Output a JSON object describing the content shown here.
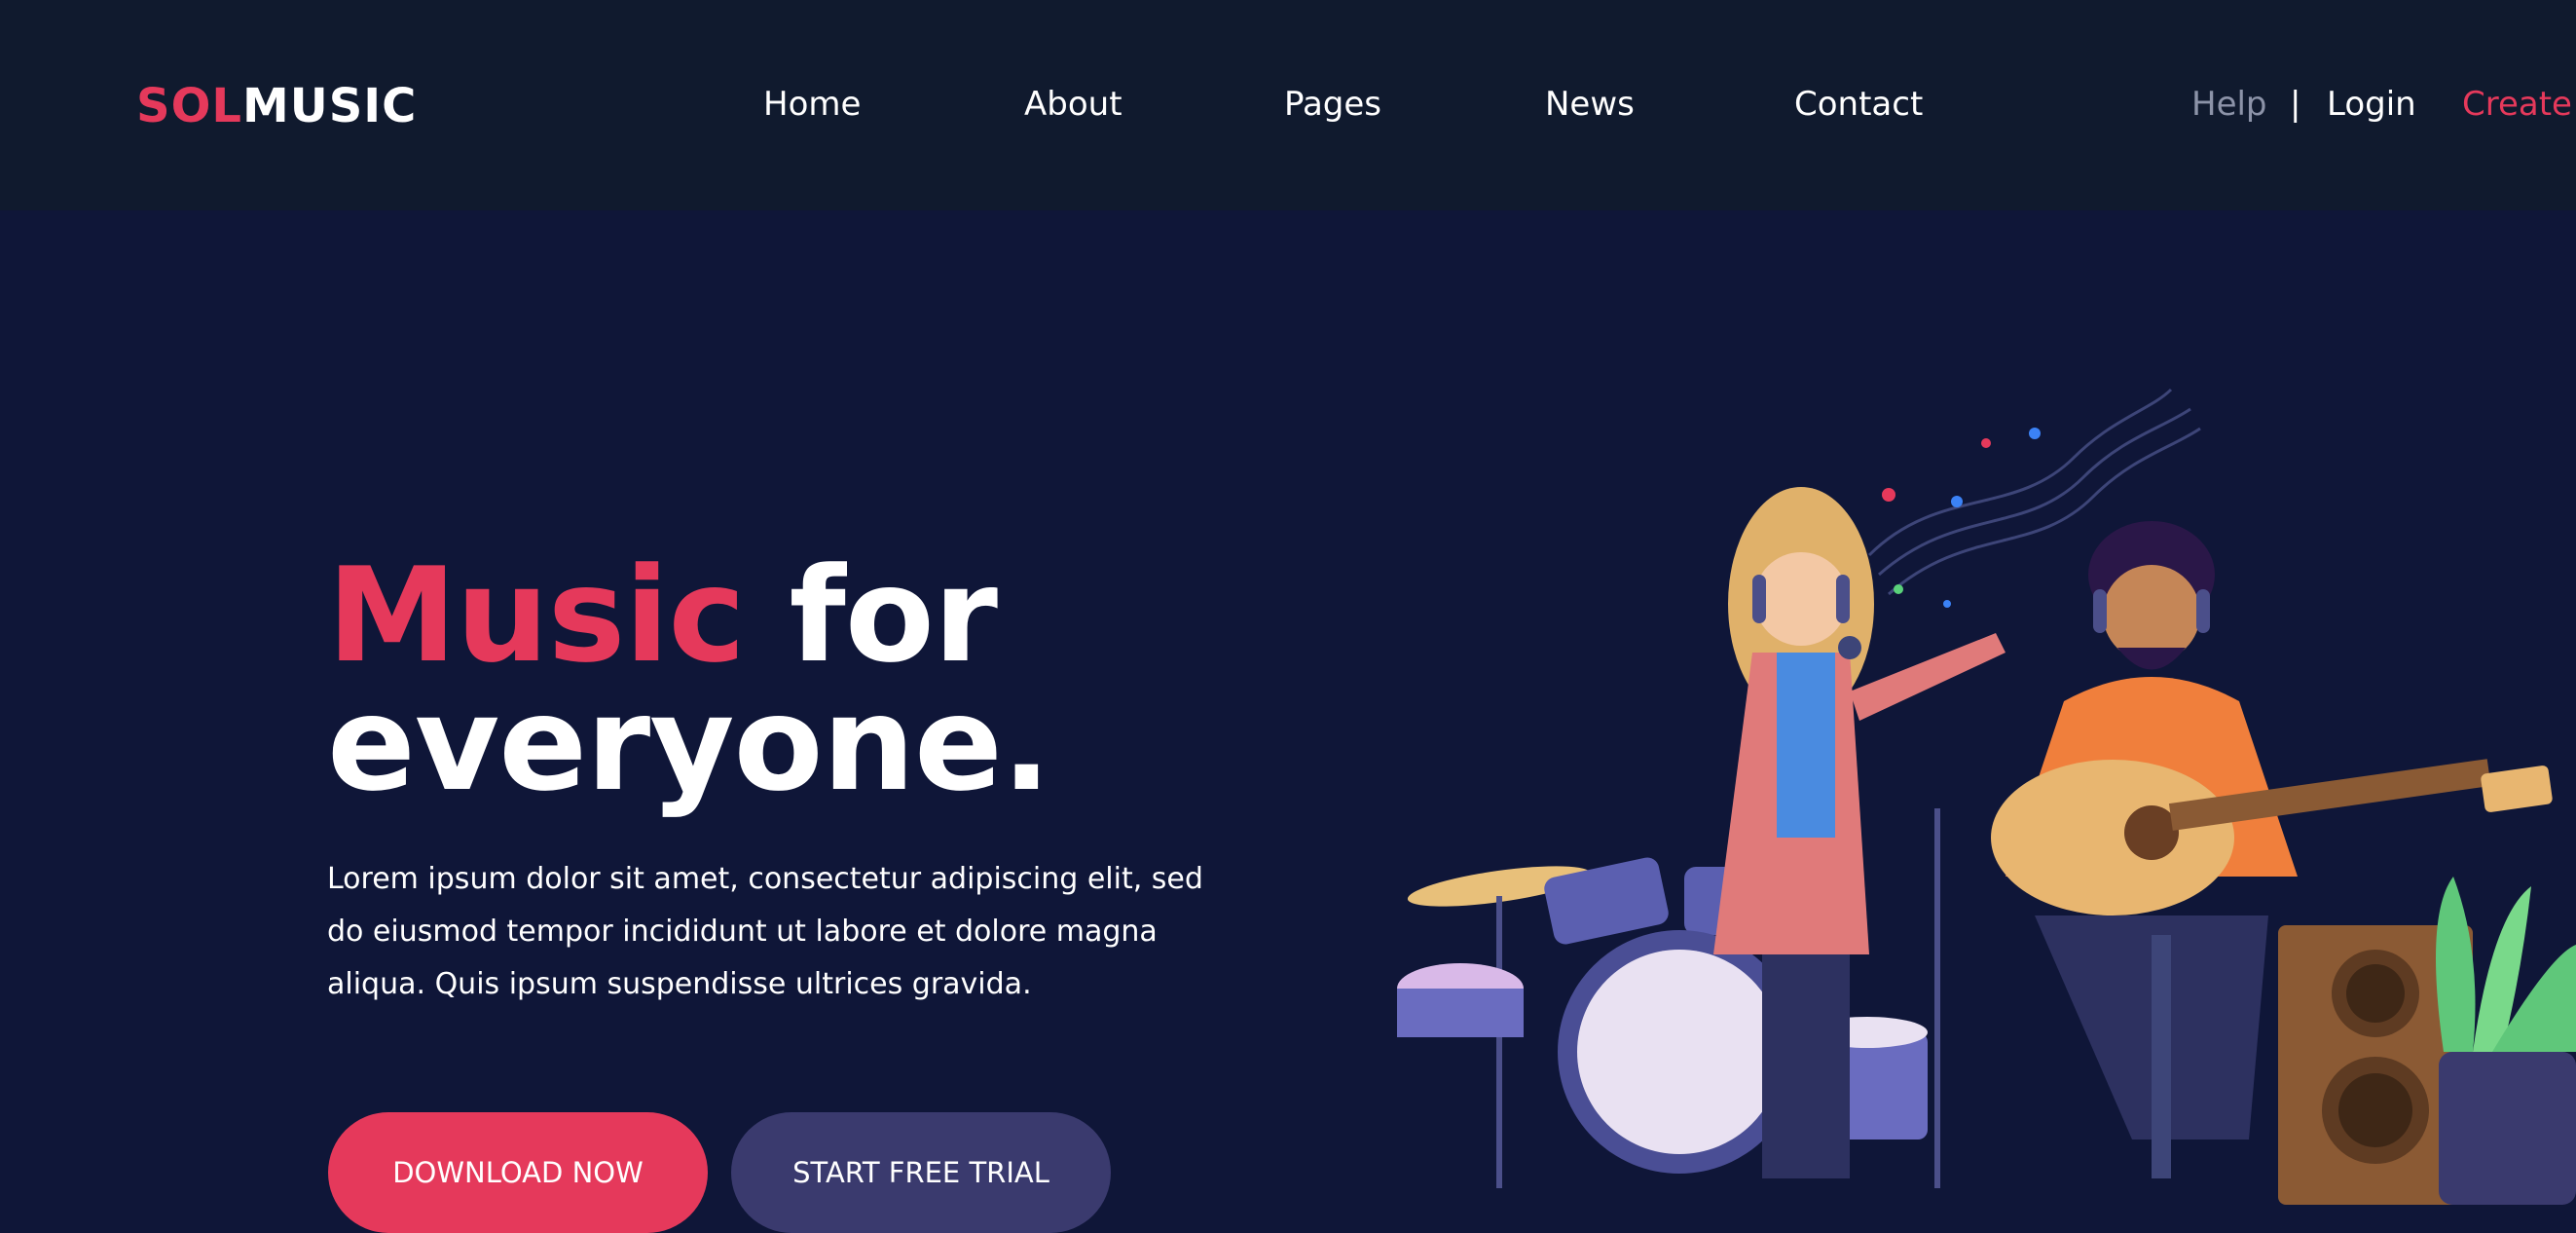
{
  "logo": {
    "part1": "SOL",
    "part2": "MUSIC"
  },
  "nav": {
    "items": [
      "Home",
      "About",
      "Pages",
      "News",
      "Contact"
    ]
  },
  "account": {
    "help": "Help",
    "separator": "|",
    "login": "Login",
    "create": "Create"
  },
  "hero": {
    "title_accent": "Music",
    "title_rest": " for",
    "title_line2": "everyone.",
    "description": "Lorem ipsum dolor sit amet, consectetur adipiscing elit, sed do eiusmod tempor incididunt ut labore et dolore magna aliqua. Quis ipsum suspendisse ultrices gravida.",
    "primary_button": "DOWNLOAD NOW",
    "secondary_button": "START FREE TRIAL"
  },
  "colors": {
    "accent": "#e5395b",
    "header_bg": "#101a2e",
    "page_bg": "#0f1638",
    "secondary_button": "#3a3a6e"
  },
  "illustration": {
    "icon": "band-illustration"
  }
}
